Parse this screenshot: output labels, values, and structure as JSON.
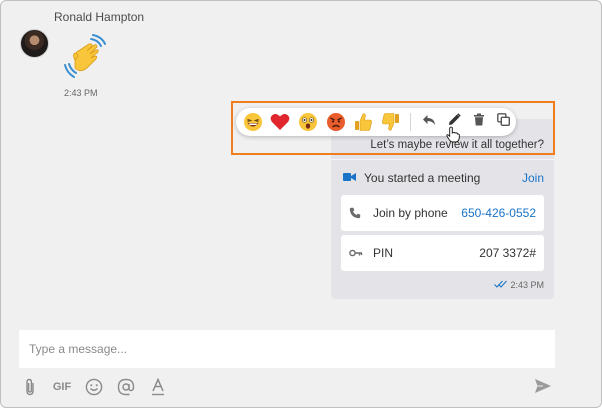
{
  "incoming": {
    "sender_name": "Ronald Hampton",
    "time": "2:43 PM",
    "emoji": "waving-hand"
  },
  "outgoing": {
    "text": "Let’s maybe review it all together?",
    "meeting": {
      "title": "You started a meeting",
      "join_label": "Join",
      "phone_label": "Join by phone",
      "phone_number": "650-426-0552",
      "pin_label": "PIN",
      "pin_value": "207 3372#"
    },
    "time": "2:43 PM",
    "status": "read"
  },
  "reaction_bar": {
    "reactions": [
      "laughing-face",
      "red-heart",
      "astonished-face",
      "angry-face",
      "thumbs-up",
      "thumbs-down"
    ],
    "actions": [
      "reply",
      "edit",
      "delete",
      "copy"
    ]
  },
  "composer": {
    "placeholder": "Type a message...",
    "value": "",
    "tools": [
      "attach",
      "gif",
      "emoji",
      "mention",
      "format"
    ],
    "gif_label": "GIF"
  },
  "colors": {
    "highlight": "#f07e1e",
    "link": "#1a73c8",
    "background": "#f0f0f0",
    "bubble": "#e4e4e8"
  }
}
